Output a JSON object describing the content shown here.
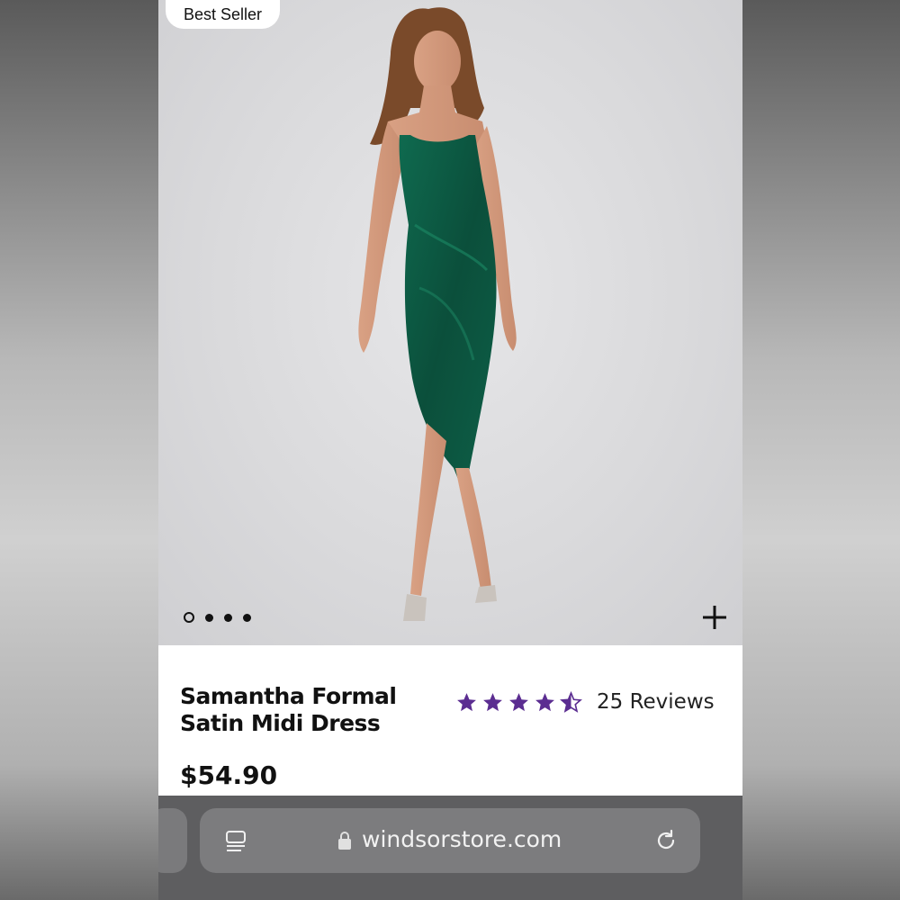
{
  "hero": {
    "badge": "Best Seller",
    "image": "green satin dress model photo",
    "carousel_total": 4,
    "carousel_active": 1,
    "zoom_icon": "plus-icon"
  },
  "product": {
    "title_line1": "Samantha Formal",
    "title_line2": "Satin Midi Dress",
    "price": "$54.90",
    "rating": 4.5,
    "reviews": "25 Reviews",
    "star_color": "#5b2d91"
  },
  "browser": {
    "url": "windsorstore.com",
    "tabs_icon": "tabs-icon",
    "lock_icon": "lock-icon",
    "reload_icon": "reload-icon"
  },
  "colors": {
    "dress": "#0d5a43",
    "accent": "#5b2d91",
    "browser_bg": "#5e5e60"
  }
}
